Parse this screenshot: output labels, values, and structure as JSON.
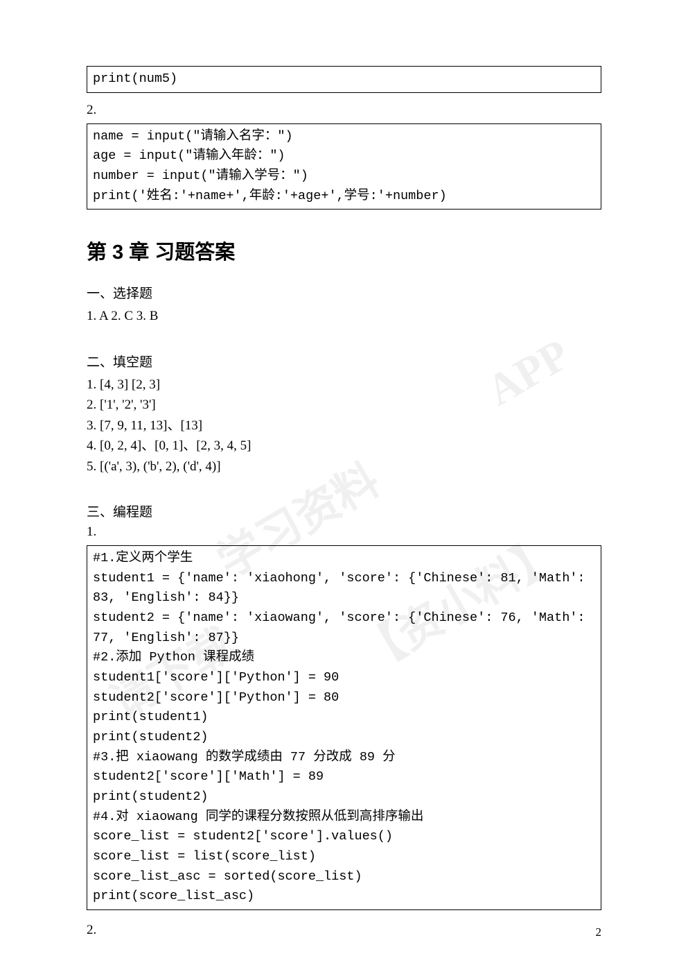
{
  "codebox1": "print(num5)",
  "label2a": "2.",
  "codebox2": "name = input(\"请输入名字：\")\nage = input(\"请输入年龄：\")\nnumber = input(\"请输入学号：\")\nprint('姓名:'+name+',年龄:'+age+',学号:'+number)",
  "chapter_title": "第 3 章 习题答案",
  "mc": {
    "heading": "一、选择题",
    "answers": "1. A      2. C      3. B"
  },
  "fill": {
    "heading": "二、填空题",
    "a1": "1. [4, 3] [2, 3]",
    "a2": "2. ['1', '2', '3']",
    "a3": "3. [7, 9, 11, 13]、[13]",
    "a4": "4. [0, 2, 4]、[0, 1]、[2, 3, 4, 5]",
    "a5": "5. [('a', 3), ('b', 2), ('d', 4)]"
  },
  "prog": {
    "heading": "三、编程题",
    "label1": "1.",
    "code1": "#1.定义两个学生\nstudent1 = {'name': 'xiaohong', 'score': {'Chinese': 81, 'Math': 83, 'English': 84}}\nstudent2 = {'name': 'xiaowang', 'score': {'Chinese': 76, 'Math': 77, 'English': 87}}\n#2.添加 Python 课程成绩\nstudent1['score']['Python'] = 90\nstudent2['score']['Python'] = 80\nprint(student1)\nprint(student2)\n#3.把 xiaowang 的数学成绩由 77 分改成 89 分\nstudent2['score']['Math'] = 89\nprint(student2)\n#4.对 xiaowang 同学的课程分数按照从低到高排序输出\nscore_list = student2['score'].values()\nscore_list = list(score_list)\nscore_list_asc = sorted(score_list)\nprint(score_list_asc)\n",
    "label2": "2."
  },
  "page_number": "2"
}
